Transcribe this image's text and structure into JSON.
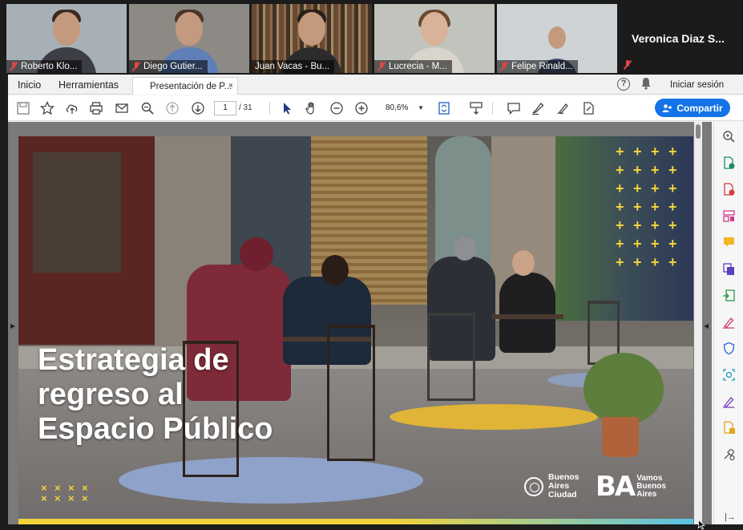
{
  "participants": [
    {
      "name": "Roberto Klo...",
      "muted": true,
      "shirt": "#3d3d45",
      "bg": "#a7b0b6"
    },
    {
      "name": "Diego Gutier...",
      "muted": true,
      "shirt": "#5e7fb8",
      "bg": "#8d8a85"
    },
    {
      "name": "Juan Vacas - Bu...",
      "muted": false,
      "shirt": "#2b2b2b",
      "bg": "#5b4a38"
    },
    {
      "name": "Lucrecia - M...",
      "muted": true,
      "shirt": "#d9d4cc",
      "bg": "#c1c4bd"
    },
    {
      "name": "Felipe Rinald...",
      "muted": true,
      "shirt": "#4b5a75",
      "bg": "#cfd3d6"
    }
  ],
  "active_speaker": {
    "name": "Veronica Diaz S...",
    "muted": true
  },
  "menubar": {
    "home": "Inicio",
    "tools": "Herramientas",
    "tab_title": "Presentación de P...",
    "tab_close": "×",
    "help": "?",
    "sign_in": "Iniciar sesión"
  },
  "toolbar": {
    "current_page": "1",
    "total_pages": "/ 31",
    "zoom": "80,6%",
    "share_label": "Compartir",
    "accent": "#1473e6"
  },
  "slide": {
    "headline_1": "Estrategia de",
    "headline_2": "regreso al",
    "headline_3": "Espacio Público",
    "plus_mark": "+",
    "x_mark": "×",
    "logo1_line1": "Buenos",
    "logo1_line2": "Aires",
    "logo1_line3": "Ciudad",
    "logo2_mark": "BA",
    "logo2_line1": "Vamos",
    "logo2_line2": "Buenos",
    "logo2_line3": "Aires",
    "yellow": "#f2d33b"
  }
}
